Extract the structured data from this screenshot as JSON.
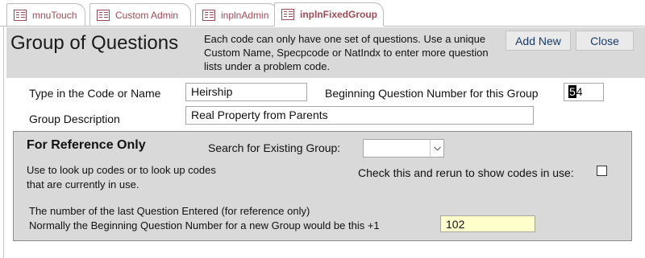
{
  "tabs": [
    {
      "label": "mnuTouch",
      "icon": "form-icon",
      "active": false
    },
    {
      "label": "Custom Admin",
      "icon": "form-icon",
      "active": false
    },
    {
      "label": "inplnAdmin",
      "icon": "form-icon",
      "active": false
    },
    {
      "label": "inplnFixedGroup",
      "icon": "form-icon",
      "active": true
    }
  ],
  "header": {
    "title": "Group of Questions",
    "description": "Each code can only have one set of questions. Use a unique Custom Name, Specpcode or NatIndx to enter more question lists under a problem code.",
    "add_new_label": "Add New",
    "close_label": "Close"
  },
  "form": {
    "code_label": "Type in the Code or Name",
    "code_value": "Heirship",
    "begin_label": "Beginning Question Number for this Group",
    "begin_value_selected": "5",
    "begin_value_rest": "4",
    "description_label": "Group Description",
    "description_value": "Real Property from Parents"
  },
  "reference": {
    "title": "For Reference Only",
    "search_label": "Search for Existing Group:",
    "search_value": "",
    "help_text": "Use to look up codes or to look up codes that are currently in use.",
    "check_label": "Check this and rerun to show codes in use:",
    "check_value": false,
    "last_line1": "The number of the last Question Entered (for reference only)",
    "last_line2": "Normally the Beginning Question Number for a new Group would be this +1",
    "last_value": "102"
  },
  "colors": {
    "tab_text": "#a24a55",
    "header_bg": "#d9d9d9",
    "button_text": "#173a6b",
    "highlight_field": "#ffffcc"
  }
}
